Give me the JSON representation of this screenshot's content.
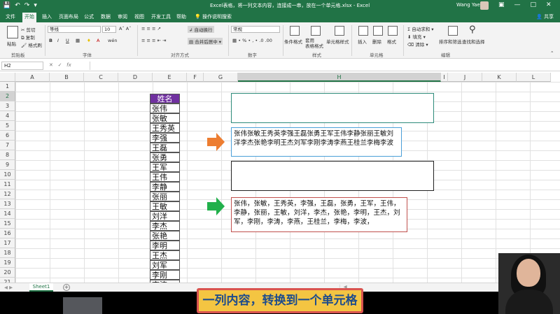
{
  "titlebar": {
    "title": "Excel表格，将一列文本内容，连接成一串，放在一个单元格.xlsx - Excel",
    "user": "Wang Yae",
    "save_icon": "save-icon",
    "undo_icon": "undo-icon",
    "redo_icon": "redo-icon"
  },
  "tabs": [
    "文件",
    "开始",
    "插入",
    "页面布局",
    "公式",
    "数据",
    "审阅",
    "视图",
    "开发工具",
    "帮助",
    "操作说明搜索"
  ],
  "share_label": "共享",
  "ribbon": {
    "clipboard": {
      "cut": "剪切",
      "copy": "复制",
      "format_painter": "格式刷",
      "paste": "粘贴",
      "label": "剪贴板"
    },
    "font": {
      "name": "等线",
      "size": "10",
      "bold": "B",
      "italic": "I",
      "underline": "U",
      "label": "字体",
      "wen": "wén"
    },
    "alignment": {
      "wrap": "自动换行",
      "merge": "合并后居中",
      "label": "对齐方式"
    },
    "number": {
      "format": "常规",
      "label": "数字"
    },
    "styles": {
      "conditional": "条件格式",
      "table": "套用\n表格格式",
      "cell": "单元格样式",
      "label": "样式"
    },
    "cells": {
      "insert": "插入",
      "delete": "删除",
      "format": "格式",
      "label": "单元格"
    },
    "editing": {
      "autosum": "自动求和",
      "fill": "填充",
      "clear": "清除",
      "sort": "排序和筛选",
      "find": "查找和选择",
      "label": "编辑"
    }
  },
  "formula": {
    "namebox": "H2",
    "fx": "fx",
    "value": ""
  },
  "columns": [
    "A",
    "B",
    "C",
    "D",
    "E",
    "F",
    "G",
    "H",
    "I",
    "J",
    "K",
    "L"
  ],
  "selected_column": "H",
  "rows": [
    "1",
    "2",
    "3",
    "4",
    "5",
    "6",
    "7",
    "8",
    "9",
    "10",
    "11",
    "12",
    "13",
    "14",
    "15",
    "16",
    "17",
    "18",
    "19",
    "20",
    "21"
  ],
  "selected_row": "2",
  "names": {
    "header": "姓名",
    "list": [
      "张伟",
      "张敏",
      "王秀英",
      "李强",
      "王磊",
      "张勇",
      "王军",
      "王伟",
      "李静",
      "张丽",
      "王敏",
      "刘洋",
      "李杰",
      "张艳",
      "李明",
      "王杰",
      "刘军",
      "李刚",
      "李涛"
    ]
  },
  "boxes": {
    "concat_text": "张伟张敏王秀英李强王磊张勇王军王伟李静张丽王敏刘洋李杰张艳李明王杰刘军李刚李涛李燕王桂兰李梅李波",
    "delimited_text": "张伟，张敏，王秀英，李强，王磊，张勇，王军，王伟，李静，张丽，王敏，刘洋，李杰，张艳，李明，王杰，刘军，李刚，李涛，李燕，王桂兰，李梅，李波，"
  },
  "sheet": {
    "tab": "Sheet1",
    "add": "+"
  },
  "caption": "一列内容，转换到一个单元格",
  "colors": {
    "excel_green": "#217346",
    "purple_header": "#7030a0",
    "orange_arrow": "#ed7d31",
    "green_arrow": "#21b04b",
    "box_blue": "#4a9fd8",
    "box_red": "#c0504d",
    "box_teal": "#2e8b7a"
  }
}
